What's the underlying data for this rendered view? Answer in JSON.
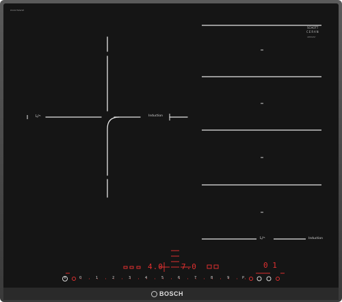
{
  "model_number": "PXX975KW1E",
  "glass_brand": {
    "line1": "SCHOTT",
    "line2": "CERAN",
    "line3": "GERMANY"
  },
  "zone_labels": {
    "flexinduction_left": "Induction",
    "flexinduction_bottom": "Induction"
  },
  "control_panel": {
    "power_display_left": "4.0",
    "power_display_center": "7.0",
    "timer_display": "0 1",
    "slider_scale": [
      "0",
      "1",
      "2",
      "3",
      "4",
      "5",
      "6",
      "7",
      "8",
      "9",
      "P"
    ]
  },
  "brand_logo": "BOSCH",
  "colors": {
    "glass": "#151515",
    "frame": "#4a4a4a",
    "zone_line": "#e8e8e8",
    "control_red": "#e03030"
  }
}
